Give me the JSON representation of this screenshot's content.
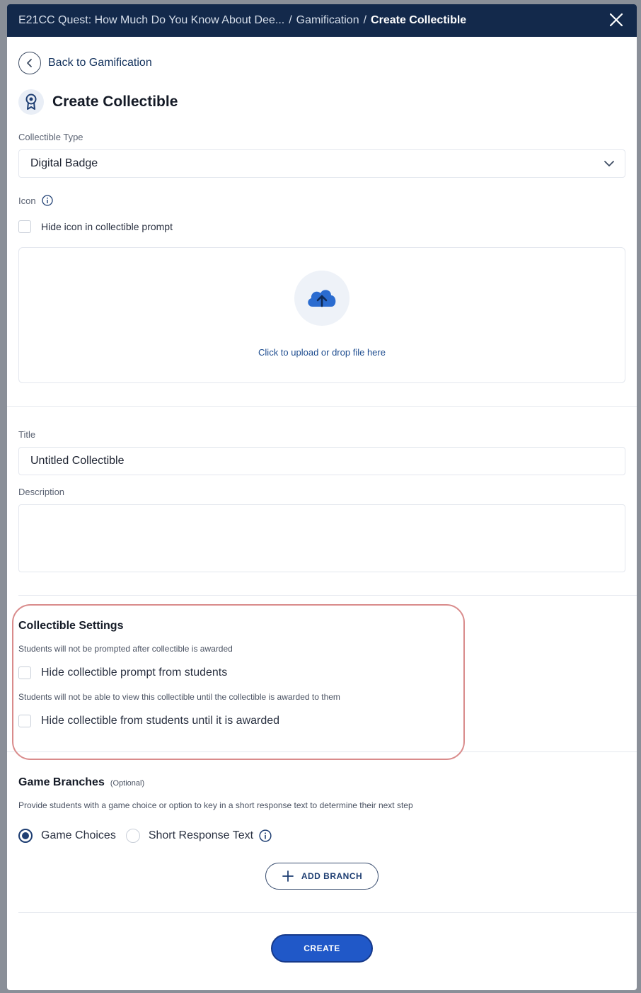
{
  "breadcrumb": {
    "items": [
      "E21CC Quest: How Much Do You Know About Dee...",
      "Gamification"
    ],
    "current": "Create Collectible",
    "separator": "/"
  },
  "back_label": "Back to Gamification",
  "page_title": "Create Collectible",
  "collectible_type": {
    "label": "Collectible Type",
    "value": "Digital Badge"
  },
  "icon_section": {
    "label": "Icon",
    "hide_checkbox_label": "Hide icon in collectible prompt",
    "upload_text": "Click to upload or drop file here"
  },
  "title_field": {
    "label": "Title",
    "value": "Untitled Collectible"
  },
  "description_field": {
    "label": "Description",
    "value": ""
  },
  "collectible_settings": {
    "title": "Collectible Settings",
    "hint1": "Students will not be prompted after collectible is awarded",
    "option1": "Hide collectible prompt from students",
    "hint2": "Students will not be able to view this collectible until the collectible is awarded to them",
    "option2": "Hide collectible from students until it is awarded"
  },
  "game_branches": {
    "title": "Game Branches",
    "optional": "(Optional)",
    "description": "Provide students with a game choice or option to key in a short response text to determine their next step",
    "radio1": "Game Choices",
    "radio2": "Short Response Text",
    "selected": "Game Choices",
    "add_branch": "ADD BRANCH"
  },
  "create_label": "CREATE",
  "colors": {
    "header_bg": "#13294b",
    "primary": "#2058c8",
    "highlight": "#d98b8b"
  }
}
